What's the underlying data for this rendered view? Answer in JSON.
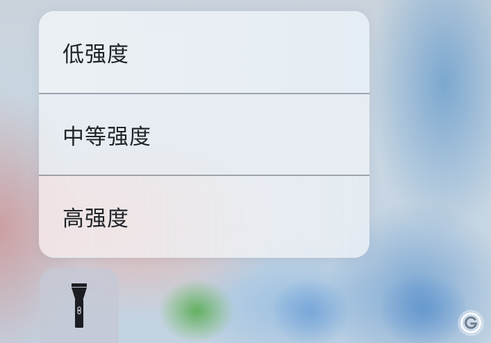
{
  "flashlight_menu": {
    "items": [
      {
        "label": "低强度"
      },
      {
        "label": "中等强度"
      },
      {
        "label": "高强度"
      }
    ]
  },
  "control_center": {
    "flashlight_icon": "flashlight-icon"
  },
  "watermark": {
    "icon": "watermark-g-logo"
  }
}
